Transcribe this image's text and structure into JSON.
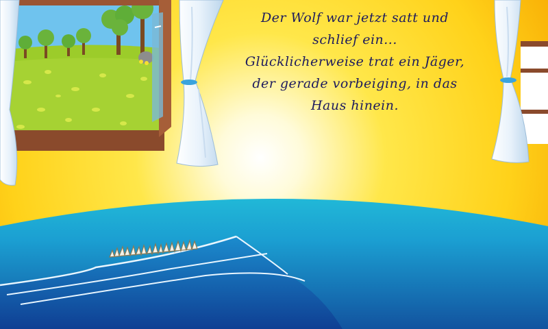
{
  "story": {
    "lines": [
      "Der Wolf war jetzt satt und",
      "schlief ein...",
      "Glücklicherweise trat ein Jäger,",
      "der gerade vorbeiging, in das",
      "Haus hinein."
    ]
  },
  "colors": {
    "background_glow": "#ffffff",
    "background_warm": "#ffd21a",
    "background_edge": "#f7a600",
    "window_frame": "#8a4a2c",
    "meadow": "#9ccc2a",
    "sky": "#6fc3ee",
    "tree_foliage": "#6ab33b",
    "blanket_light": "#20b6d6",
    "blanket_dark": "#1253a6",
    "text": "#1c1a5e"
  },
  "icons": {
    "window": "open-window-illustration",
    "curtain": "white-curtain-illustration",
    "bed": "blue-blanket-illustration",
    "wolf_hair": "wolf-fur-tuft-illustration"
  }
}
